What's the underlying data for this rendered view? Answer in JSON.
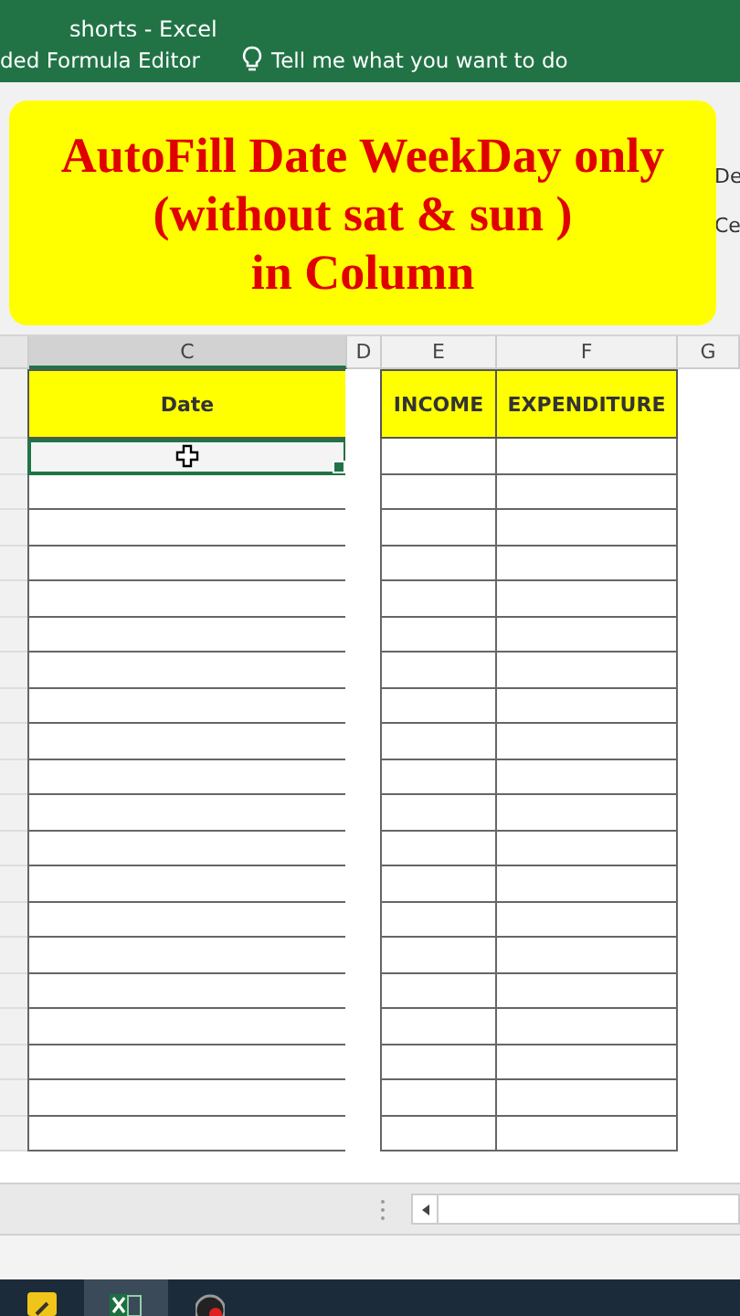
{
  "window": {
    "title": "shorts - Excel"
  },
  "ribbon": {
    "command": "ded Formula Editor",
    "tell_me": "Tell me what you want to do",
    "cut_labels": [
      "De",
      "Ce"
    ]
  },
  "banner": {
    "lines": [
      "AutoFill Date WeekDay only",
      "(without sat & sun )",
      "in Column"
    ]
  },
  "columns": [
    {
      "label": "C",
      "selected": true
    },
    {
      "label": "D",
      "selected": false
    },
    {
      "label": "E",
      "selected": false
    },
    {
      "label": "F",
      "selected": false
    },
    {
      "label": "G",
      "selected": false
    }
  ],
  "table": {
    "headers": [
      "Date",
      "INCOME",
      "EXPENDITURE"
    ],
    "rows": [
      {
        "selected": true
      },
      {
        "selected": false
      },
      {
        "selected": false
      },
      {
        "selected": false
      },
      {
        "selected": false
      },
      {
        "selected": false
      },
      {
        "selected": false
      },
      {
        "selected": false
      },
      {
        "selected": false
      },
      {
        "selected": false
      },
      {
        "selected": false
      },
      {
        "selected": false
      },
      {
        "selected": false
      },
      {
        "selected": false
      },
      {
        "selected": false
      },
      {
        "selected": false
      },
      {
        "selected": false
      },
      {
        "selected": false
      },
      {
        "selected": false
      },
      {
        "selected": false
      }
    ]
  }
}
